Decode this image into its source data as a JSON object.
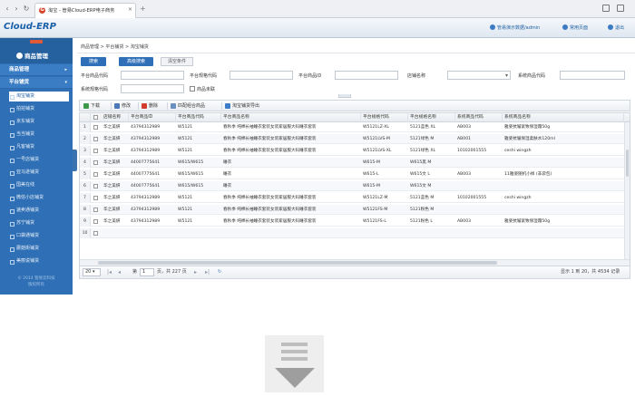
{
  "browser": {
    "tab_title": "淘宝 - 管易Cloud-ERP电子商务",
    "tab_close": "×",
    "new_tab": "+"
  },
  "app": {
    "logo": "Cloud-ERP",
    "user": "管易演示数据/admin",
    "home": "常用页面",
    "logout": "退出"
  },
  "sidebar": {
    "title": "商品管理",
    "groups": [
      "商品管理",
      "平台铺货"
    ],
    "items": [
      "淘宝铺货",
      "拍拍铺货",
      "京东铺货",
      "当当铺货",
      "凡客铺货",
      "一号店铺货",
      "亚马逊铺货",
      "国美在线",
      "微信小店铺货",
      "速卖通铺货",
      "苏宁铺货",
      "口袋通铺货",
      "蘑菇街铺货",
      "美丽说铺货"
    ],
    "active_index": 0,
    "footer_line1": "© 2014 管易云科技",
    "footer_line2": "版权所有"
  },
  "breadcrumb": "商品管理 > 平台铺货 > 淘宝铺货",
  "search": {
    "search_btn": "搜索",
    "advanced_btn": "高级搜索",
    "clear_btn": "清空条件",
    "labels": {
      "platform_code": "平台商品代码",
      "platform_sku_code": "平台规格代码",
      "platform_id": "平台商品ID",
      "shop_name": "店铺名称",
      "system_code": "系统商品代码",
      "sku_code": "系统规格代码",
      "unlinked": "商品未联"
    }
  },
  "toolbar": {
    "download": "下载",
    "edit": "修改",
    "delete": "删除",
    "match": "匹配组合商品",
    "export": "淘宝铺货导出"
  },
  "grid": {
    "headers": [
      "店铺名称",
      "平台商品ID",
      "平台商品代码",
      "平台商品名称",
      "平台规格代码",
      "平台规格名称",
      "系统商品代码",
      "系统商品名称"
    ],
    "rows": [
      [
        "华之美妍",
        "43794312989",
        "W5121",
        "春秋季 纯棉长袖睡衣套装女装家居服大码睡衣套装",
        "W5121LZ-XL",
        "5121蓝色 XL",
        "AB003",
        "雅姿抗皱紧致保湿霜50g"
      ],
      [
        "华之美妍",
        "43794312989",
        "W5121",
        "春秋季 纯棉长袖睡衣套装女装家居服大码睡衣套装",
        "W5121LVS-M",
        "5121绿色 M",
        "AB001",
        "雅姿抗皱保湿柔肤水120ml"
      ],
      [
        "华之美妍",
        "43794312989",
        "W5121",
        "春秋季 纯棉长袖睡衣套装女装家居服大码睡衣套装",
        "W5121LVS-XL",
        "5121绿色 XL",
        "10102001555",
        "ceshi wingzh"
      ],
      [
        "华之美妍",
        "44007775641",
        "W615/W615",
        "睡衣",
        "W615-M",
        "W615黑 M",
        "",
        ""
      ],
      [
        "华之美妍",
        "44007775641",
        "W615/W615",
        "睡衣",
        "W615-L",
        "W615文 L",
        "AB003",
        "11雅姿随机小样 (非袋包)"
      ],
      [
        "华之美妍",
        "44007775641",
        "W615/W615",
        "睡衣",
        "W615-M",
        "W615文 M",
        "",
        ""
      ],
      [
        "华之美妍",
        "43794312989",
        "W5121",
        "春秋季 纯棉长袖睡衣套装女装家居服大码睡衣套装",
        "W5121LZ-M",
        "5121蓝色 M",
        "10102001555",
        "ceshi wingzh"
      ],
      [
        "华之美妍",
        "43794312989",
        "W5121",
        "春秋季 纯棉长袖睡衣套装女装家居服大码睡衣套装",
        "W5121FS-M",
        "5121粉色 M",
        "",
        ""
      ],
      [
        "华之美妍",
        "43794312989",
        "W5121",
        "春秋季 纯棉长袖睡衣套装女装家居服大码睡衣套装",
        "W5121FS-L",
        "5121粉色 L",
        "AB003",
        "雅姿抗皱紧致保湿霜50g"
      ]
    ],
    "row_numbers": [
      "1",
      "2",
      "3",
      "4",
      "5",
      "6",
      "7",
      "8",
      "9",
      "10"
    ]
  },
  "pager": {
    "page_size": "20",
    "page_prefix": "第",
    "page_value": "1",
    "page_suffix": "页，共 227 页",
    "summary": "显示 1 到 20，共 4534 记录"
  }
}
